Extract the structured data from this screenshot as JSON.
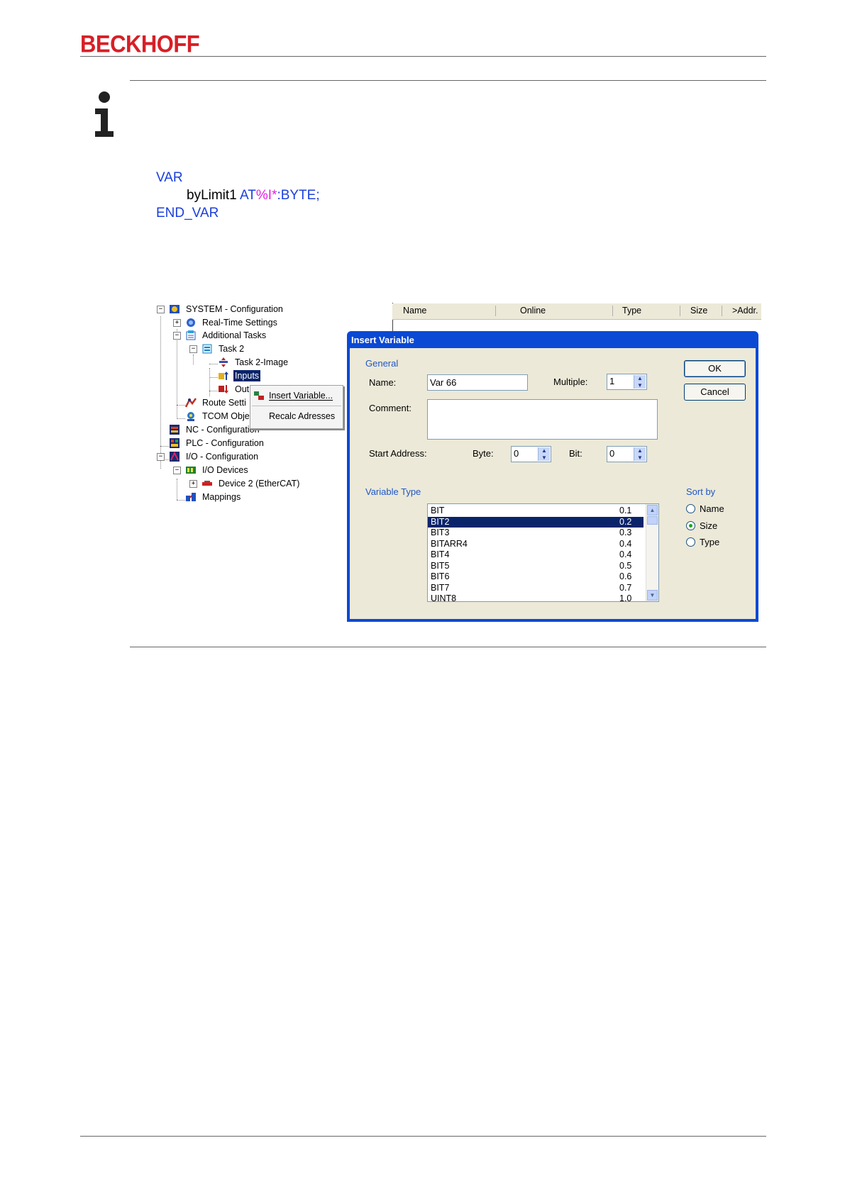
{
  "header": {
    "brand": "BECKHOFF"
  },
  "code": {
    "line1": "VAR",
    "line2_name": "byLimit1",
    "line2_at": "AT",
    "line2_addr": "%I*",
    "line2_type": ":BYTE;",
    "line3": "END_VAR"
  },
  "tree": {
    "items": [
      {
        "label": "SYSTEM - Configuration",
        "expander": "−"
      },
      {
        "label": "Real-Time Settings",
        "expander": "+"
      },
      {
        "label": "Additional Tasks",
        "expander": "−"
      },
      {
        "label": "Task 2",
        "expander": "−"
      },
      {
        "label": "Task 2-Image"
      },
      {
        "label": "Inputs"
      },
      {
        "label": "Out"
      },
      {
        "label": "Route Setti"
      },
      {
        "label": "TCOM Obje"
      },
      {
        "label": "NC - Configuration"
      },
      {
        "label": "PLC - Configuration"
      },
      {
        "label": "I/O - Configuration",
        "expander": "−"
      },
      {
        "label": "I/O Devices",
        "expander": "−"
      },
      {
        "label": "Device 2 (EtherCAT)",
        "expander": "+"
      },
      {
        "label": "Mappings"
      }
    ]
  },
  "context_menu": {
    "item1": "Insert Variable...",
    "item2": "Recalc Adresses"
  },
  "list_header": {
    "col1": "Name",
    "col2": "Online",
    "col3": "Type",
    "col4": "Size",
    "col5": ">Addr."
  },
  "dialog": {
    "title": "Insert Variable",
    "group_general": "General",
    "name_label": "Name:",
    "name_value": "Var 66",
    "multiple_label": "Multiple:",
    "multiple_value": "1",
    "comment_label": "Comment:",
    "comment_value": "",
    "start_address_label": "Start Address:",
    "byte_label": "Byte:",
    "byte_value": "0",
    "bit_label": "Bit:",
    "bit_value": "0",
    "ok_label": "OK",
    "cancel_label": "Cancel",
    "group_variable_type": "Variable Type",
    "sort_by_label": "Sort by",
    "sort_options": [
      "Name",
      "Size",
      "Type"
    ],
    "sort_selected": "Size",
    "types": [
      {
        "name": "BIT",
        "size": "0.1"
      },
      {
        "name": "BIT2",
        "size": "0.2",
        "selected": true
      },
      {
        "name": "BIT3",
        "size": "0.3"
      },
      {
        "name": "BITARR4",
        "size": "0.4"
      },
      {
        "name": "BIT4",
        "size": "0.4"
      },
      {
        "name": "BIT5",
        "size": "0.5"
      },
      {
        "name": "BIT6",
        "size": "0.6"
      },
      {
        "name": "BIT7",
        "size": "0.7"
      },
      {
        "name": "UINT8",
        "size": "1.0"
      }
    ]
  },
  "colors": {
    "brand": "#d71f26",
    "keyword": "#1a3fdc",
    "address": "#e020e0",
    "dialog_frame": "#0a49d4",
    "selection": "#0a246a"
  }
}
